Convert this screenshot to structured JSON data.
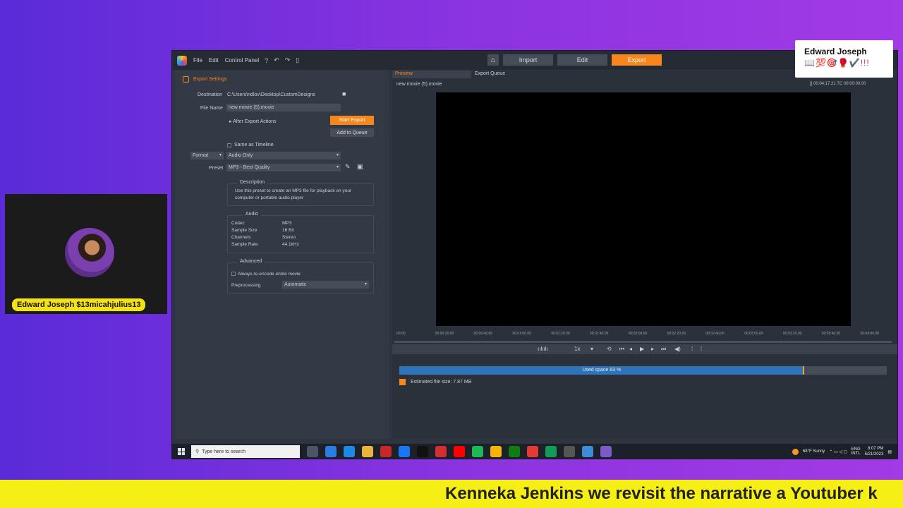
{
  "titlebar": {
    "menu": [
      "File",
      "Edit",
      "Control Panel"
    ],
    "tabs": [
      "Import",
      "Edit",
      "Export"
    ],
    "active_tab": "Export"
  },
  "export_settings": {
    "header": "Export Settings",
    "destination_label": "Destination",
    "destination_value": "C:\\Users\\ndlov\\Desktop\\CustomDesigns",
    "filename_label": "File Name",
    "filename_value": "new movie (5).movie",
    "after_export": "After Export Actions",
    "start_export": "Start Export",
    "add_to_queue": "Add to Queue",
    "same_as_timeline": "Same as Timeline",
    "format_label": "Format",
    "format_value": "Audio Only",
    "preset_label": "Preset",
    "preset_value": "MP3 - Best Quality",
    "description_title": "Description",
    "description_text": "Use this preset to create an MP3 file for playback on your computer or portable audio player",
    "audio_title": "Audio",
    "audio": [
      {
        "key": "Codec",
        "value": "MP3"
      },
      {
        "key": "Sample Size",
        "value": "16 Bit"
      },
      {
        "key": "Channels",
        "value": "Stereo"
      },
      {
        "key": "Sample Rate",
        "value": "44.1kHz"
      }
    ],
    "advanced_title": "Advanced",
    "reencode": "Always re-encode entire movie",
    "preprocessing_label": "Preprocessing",
    "preprocessing_value": "Automatic"
  },
  "preview": {
    "tab_preview": "Preview",
    "tab_queue": "Export Queue",
    "movie_name": "new movie (5).movie",
    "timecode": "[] 00:04:17.21  TC 00:00:00.00",
    "ruler_labels": [
      "00:00",
      "00:00:20.00",
      "00:00:40.00",
      "00:01:00.00",
      "00:01:20.00",
      "00:01:40.00",
      "00:02:00.00",
      "00:02:20.00",
      "00:02:40.00",
      "00:03:00.00",
      "00:03:20.00",
      "00:03:40.00",
      "00:04:00.00"
    ],
    "speed": "1x",
    "used_space": "Used space 83 %",
    "used_space_pct": 83,
    "file_size": "Estimated file size: 7.87 MB"
  },
  "taskbar": {
    "search_placeholder": "Type here to search",
    "weather": "68°F  Sunny",
    "lang": "ENG\nINTL",
    "time": "8:07 PM",
    "date": "5/21/2023"
  },
  "overlay": {
    "card_name": "Edward Joseph",
    "card_emoji": "📖💯🎯🥊✔️!!!",
    "cam_label": "Edward Joseph $13micahjulius13",
    "ticker": "Kenneka Jenkins we revisit the narrative a Youtuber k"
  }
}
